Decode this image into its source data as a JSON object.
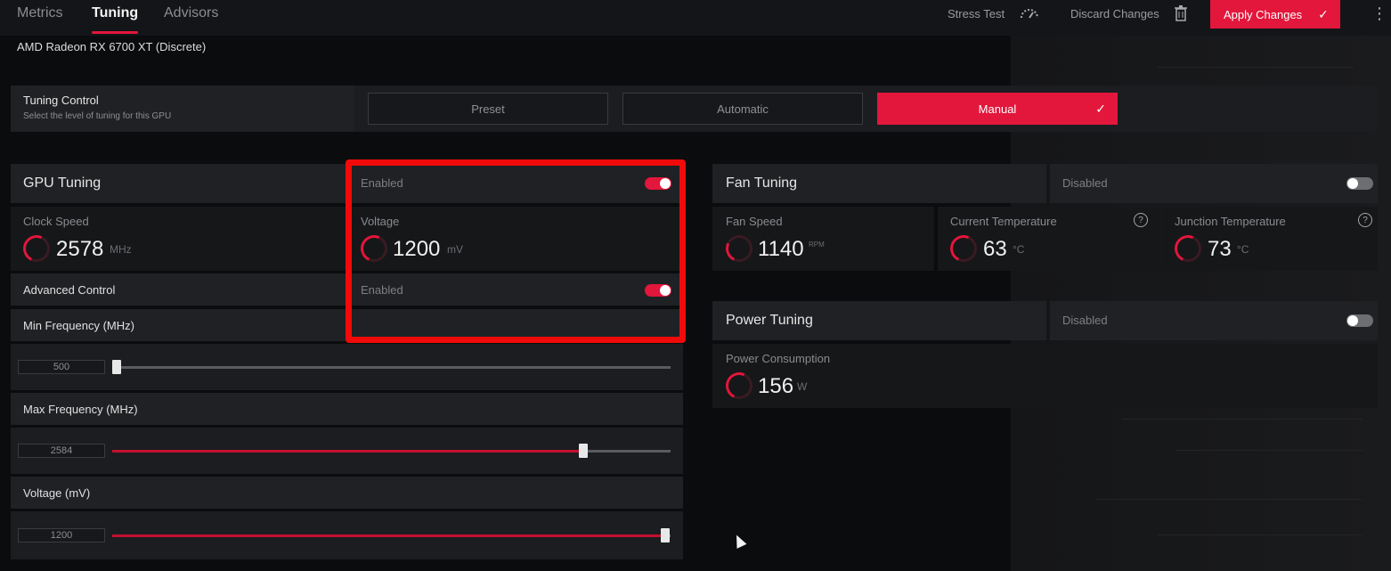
{
  "nav": {
    "tabs": [
      {
        "label": "Metrics",
        "active": false
      },
      {
        "label": "Tuning",
        "active": true
      },
      {
        "label": "Advisors",
        "active": false
      }
    ],
    "stress_test_label": "Stress Test",
    "discard_label": "Discard Changes",
    "apply_label": "Apply Changes",
    "icons": {
      "stress": "speedometer-icon",
      "discard": "trash-icon",
      "apply": "check-icon",
      "more": "kebab-menu-icon"
    }
  },
  "gpu_name": "AMD Radeon RX 6700 XT (Discrete)",
  "tuning_control": {
    "title": "Tuning Control",
    "subtitle": "Select the level of tuning for this GPU",
    "options": [
      {
        "label": "Preset",
        "selected": false
      },
      {
        "label": "Automatic",
        "selected": false
      },
      {
        "label": "Manual",
        "selected": true
      }
    ]
  },
  "gpu_tuning": {
    "title": "GPU Tuning",
    "state": "Enabled",
    "toggle_on": true,
    "clock_speed": {
      "label": "Clock Speed",
      "value": "2578",
      "unit": "MHz"
    },
    "voltage": {
      "label": "Voltage",
      "value": "1200",
      "unit": "mV"
    },
    "advanced_control": {
      "label": "Advanced Control",
      "state": "Enabled",
      "toggle_on": true
    },
    "sliders": [
      {
        "label": "Min Frequency (MHz)",
        "value": "500",
        "fraction": 0.0
      },
      {
        "label": "Max Frequency (MHz)",
        "value": "2584",
        "fraction": 0.85
      },
      {
        "label": "Voltage (mV)",
        "value": "1200",
        "fraction": 1.0
      }
    ]
  },
  "fan_tuning": {
    "title": "Fan Tuning",
    "state": "Disabled",
    "toggle_on": false,
    "fan_speed": {
      "label": "Fan Speed",
      "value": "1140",
      "unit": "RPM"
    },
    "current_temp": {
      "label": "Current Temperature",
      "value": "63",
      "unit": "°C"
    },
    "junction_temp": {
      "label": "Junction Temperature",
      "value": "73",
      "unit": "°C"
    }
  },
  "power_tuning": {
    "title": "Power Tuning",
    "state": "Disabled",
    "toggle_on": false,
    "power_consumption": {
      "label": "Power Consumption",
      "value": "156",
      "unit": "W"
    }
  },
  "colors": {
    "accent": "#e3163b",
    "highlight": "#f00a0a",
    "background": "#0b0c0e"
  }
}
